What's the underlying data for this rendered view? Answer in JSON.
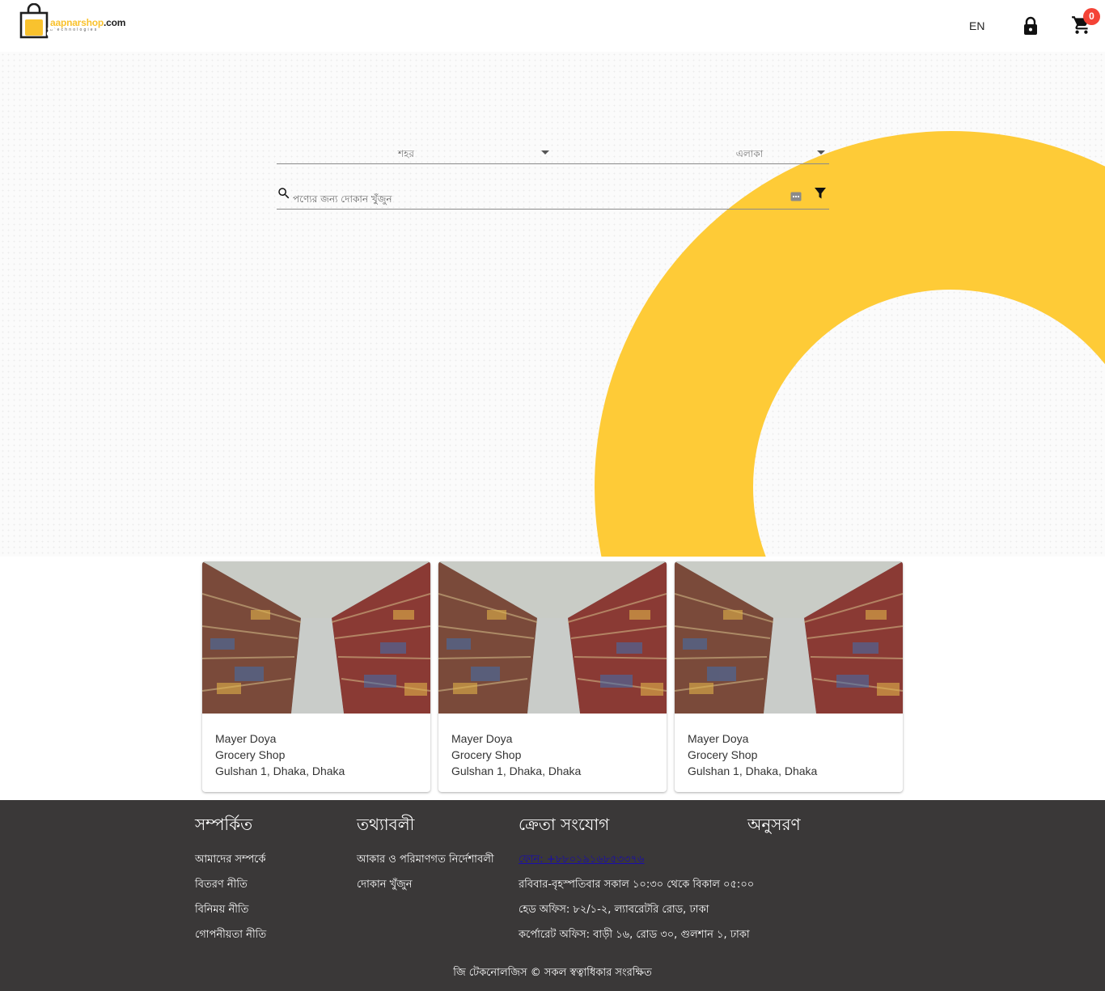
{
  "header": {
    "logo": {
      "text_main_accent": "aapnarshop",
      "text_main_tail": ".com",
      "text_sub": "gtechnologies",
      "letter": "a"
    },
    "language": "EN",
    "cart_count": "0"
  },
  "colors": {
    "accent": "#fecb37",
    "badge": "#f44336",
    "footer_bg": "#3a3838"
  },
  "search": {
    "city_label": "শহর",
    "area_label": "এলাকা",
    "placeholder": "পণ্যের জন্য দোকান খুঁজুন",
    "icons": [
      "search-icon",
      "keyboard-icon",
      "filter-icon"
    ]
  },
  "shops": [
    {
      "name": "Mayer Doya",
      "type": "Grocery Shop",
      "address": "Gulshan 1, Dhaka, Dhaka"
    },
    {
      "name": "Mayer Doya",
      "type": "Grocery Shop",
      "address": "Gulshan 1, Dhaka, Dhaka"
    },
    {
      "name": "Mayer Doya",
      "type": "Grocery Shop",
      "address": "Gulshan 1, Dhaka, Dhaka"
    }
  ],
  "footer": {
    "about": {
      "title": "সম্পর্কিত",
      "links": [
        "আমাদের সম্পর্কে",
        "বিতরণ নীতি",
        "বিনিময় নীতি",
        "গোপনীয়তা নীতি"
      ]
    },
    "info": {
      "title": "তথ্যাবলী",
      "links": [
        "আকার ও পরিমাণগত নির্দেশাবলী",
        "দোকান খুঁজুন"
      ]
    },
    "contact": {
      "title": "ক্রেতা সংযোগ",
      "phone": "ফোন: +৮৮০১৯১৬৮৫৩৩৭৬",
      "hours": "রবিবার-বৃহস্পতিবার সকাল ১০:৩০ থেকে বিকাল ০৫:০০",
      "head_office": "হেড অফিস: ৮২/১-২, ল্যাবরেটরি রোড, ঢাকা",
      "corporate_office": "কর্পোরেট অফিস: বাড়ী ১৬, রোড ৩০, গুলশান ১, ঢাকা"
    },
    "follow": {
      "title": "অনুসরণ"
    },
    "copyright": "জি টেকনোলজিস © সকল স্বত্বাধিকার সংরক্ষিত"
  }
}
